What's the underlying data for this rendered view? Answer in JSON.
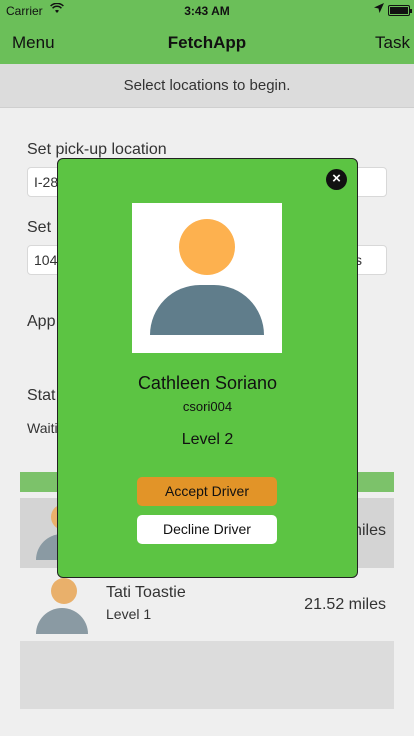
{
  "status_bar": {
    "carrier": "Carrier",
    "time": "3:43 AM"
  },
  "nav": {
    "menu_label": "Menu",
    "title": "FetchApp",
    "task_label": "Task"
  },
  "banner": {
    "text": "Select locations to begin."
  },
  "form": {
    "pickup_label": "Set pick-up location",
    "pickup_value": "I-28",
    "dropoff_label": "Set",
    "dropoff_value": "104",
    "dropoff_suffix": "s",
    "app_label": "App",
    "status_label": "Stat",
    "status_value": "Waiti"
  },
  "drivers": [
    {
      "name": "",
      "level": "",
      "distance": "miles"
    },
    {
      "name": "Tati Toastie",
      "level": "Level 1",
      "distance": "21.52 miles"
    }
  ],
  "modal": {
    "name": "Cathleen Soriano",
    "username": "csori004",
    "level": "Level 2",
    "accept_label": "Accept Driver",
    "decline_label": "Decline Driver",
    "close_glyph": "×"
  },
  "colors": {
    "nav_bg": "#6bbf59",
    "modal_bg": "#5cc443",
    "accept_bg": "#e29428",
    "avatar_head": "#fdb14f",
    "avatar_body": "#607d8b"
  }
}
